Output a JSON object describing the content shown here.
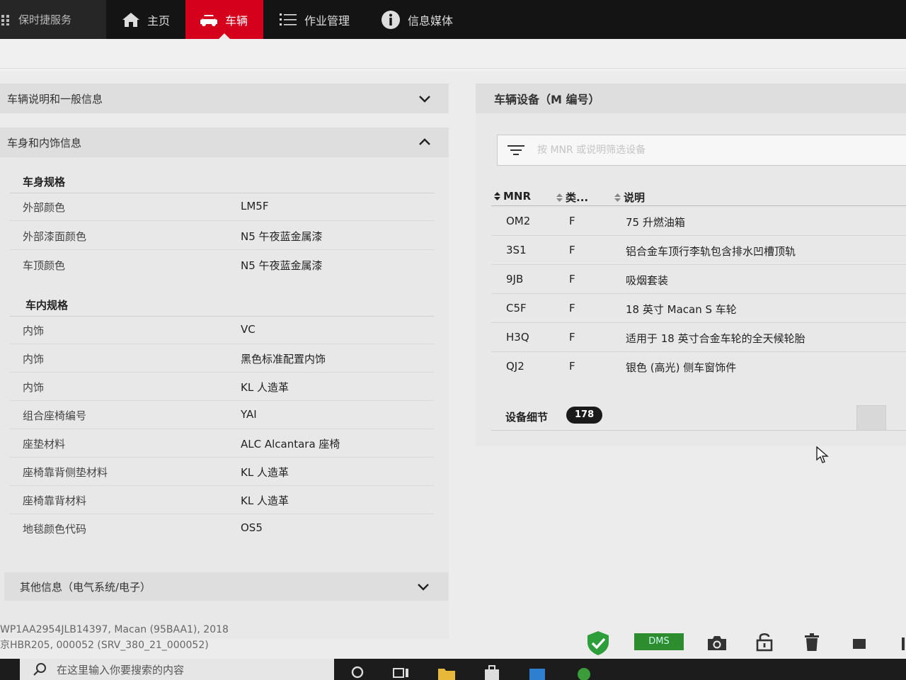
{
  "nav": {
    "brand": "保时捷服务",
    "items": [
      {
        "label": "主页",
        "icon": "home-icon"
      },
      {
        "label": "车辆",
        "icon": "car-icon",
        "active": true
      },
      {
        "label": "作业管理",
        "icon": "list-icon"
      },
      {
        "label": "信息媒体",
        "icon": "info-icon"
      }
    ]
  },
  "left": {
    "general_info": "车辆说明和一般信息",
    "body_interior": "车身和内饰信息",
    "body_spec_title": "车身规格",
    "body_specs": [
      {
        "label": "外部颜色",
        "value": "LM5F"
      },
      {
        "label": "外部漆面颜色",
        "value": "N5 午夜蓝金属漆"
      },
      {
        "label": "车顶颜色",
        "value": "N5 午夜蓝金属漆"
      }
    ],
    "interior_spec_title": "车内规格",
    "interior_specs": [
      {
        "label": "内饰",
        "value": "VC"
      },
      {
        "label": "内饰",
        "value": "黑色标准配置内饰"
      },
      {
        "label": "内饰",
        "value": "KL 人造革"
      },
      {
        "label": "组合座椅编号",
        "value": "YAI"
      },
      {
        "label": "座垫材料",
        "value": "ALC Alcantara 座椅"
      },
      {
        "label": "座椅靠背侧垫材料",
        "value": "KL 人造革"
      },
      {
        "label": "座椅靠背材料",
        "value": "KL 人造革"
      },
      {
        "label": "地毯颜色代码",
        "value": "OS5"
      }
    ],
    "other_info": "其他信息（电气系统/电子）"
  },
  "right": {
    "title": "车辆设备（M 编号）",
    "filter_placeholder": "按 MNR 或说明筛选设备",
    "columns": [
      "MNR",
      "类...",
      "说明"
    ],
    "rows": [
      [
        "OM2",
        "F",
        "75 升燃油箱"
      ],
      [
        "3S1",
        "F",
        "铝合金车顶行李轨包含排水凹槽顶轨"
      ],
      [
        "9JB",
        "F",
        "吸烟套装"
      ],
      [
        "C5F",
        "F",
        "18 英寸 Macan S 车轮"
      ],
      [
        "H3Q",
        "F",
        "适用于 18 英寸合金车轮的全天候轮胎"
      ],
      [
        "QJ2",
        "F",
        "银色 (高光) 侧车窗饰件"
      ]
    ],
    "detail_label": "设备细节",
    "detail_count": "178"
  },
  "status": {
    "line1": "WP1AA2954JLB14397, Macan (95BAA1), 2018",
    "line2": "京HBR205, 000052 (SRV_380_21_000052)",
    "dms": "DMS"
  },
  "taskbar": {
    "search_placeholder": "在这里输入你要搜索的内容"
  },
  "colors": {
    "accent": "#d5001c",
    "nav_bg": "#141414",
    "shield": "#2e9e3a"
  }
}
